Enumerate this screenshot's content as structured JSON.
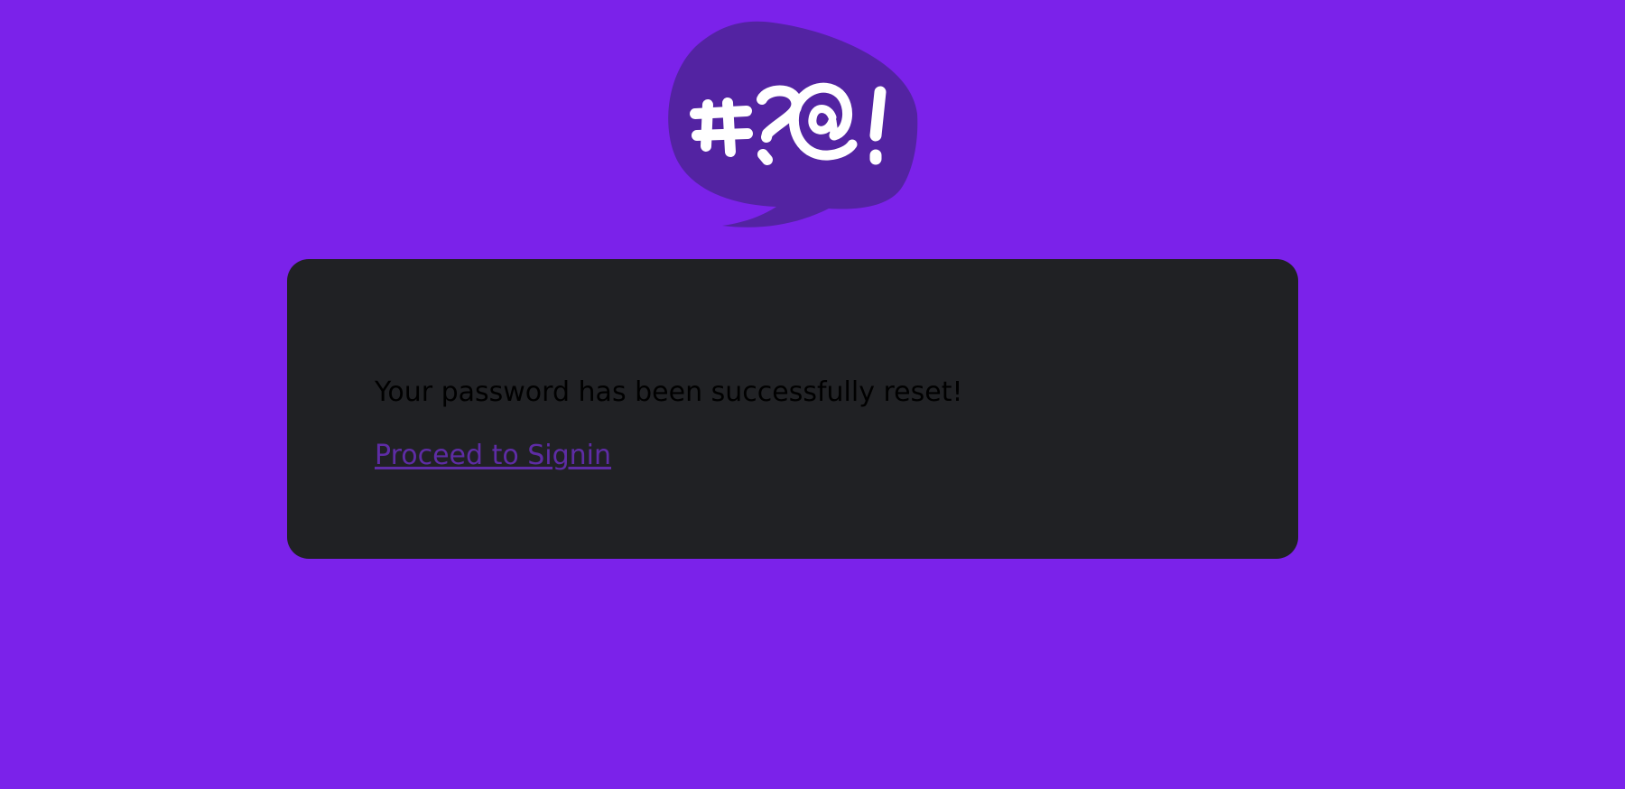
{
  "colors": {
    "page_background": "#7b22ea",
    "card_background": "#202124",
    "logo_bubble": "#5323a2",
    "logo_glyphs": "#ffffff",
    "message_text": "#000000",
    "link_text": "#5e2ca5"
  },
  "logo": {
    "icon": "speech-bubble-symbols-icon",
    "glyphs": "#?@!"
  },
  "card": {
    "message": "Your password has been successfully reset!",
    "link_label": "Proceed to Signin"
  }
}
